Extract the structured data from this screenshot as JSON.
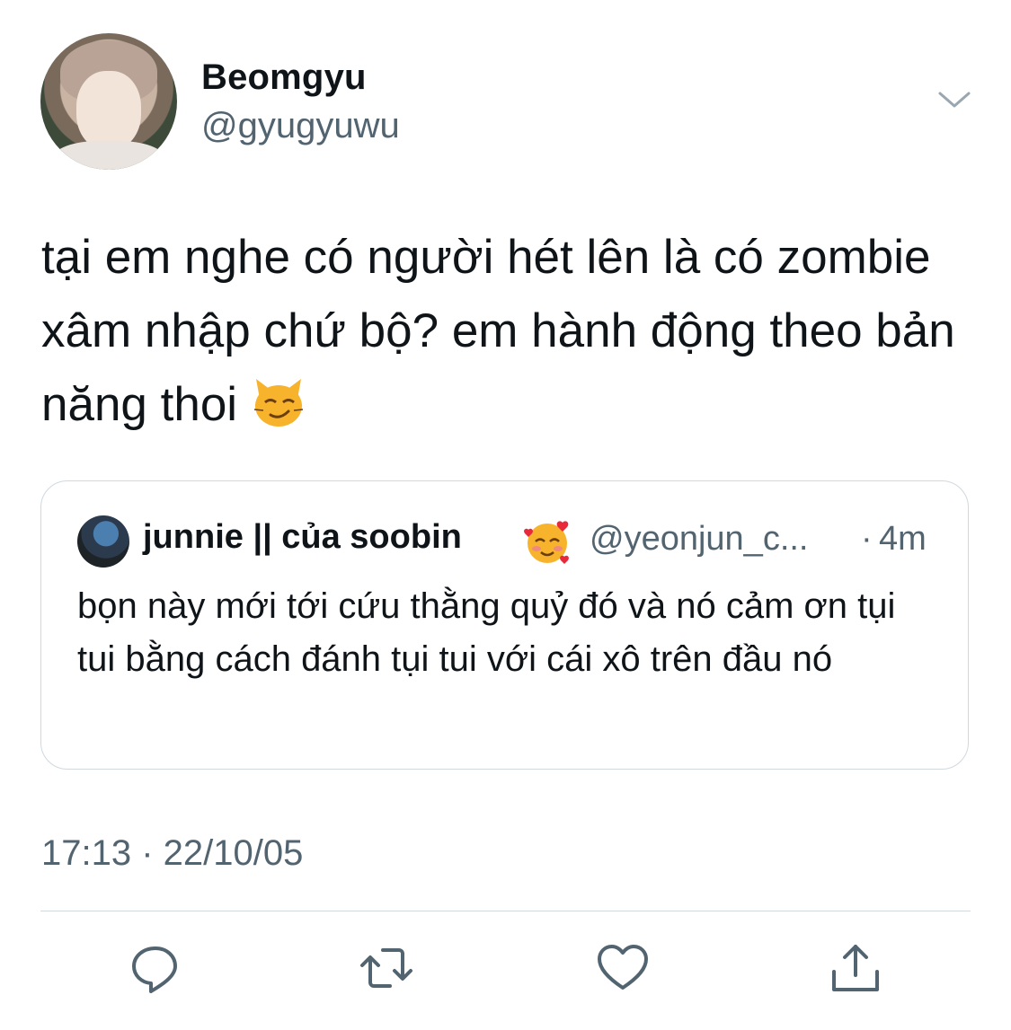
{
  "author": {
    "display_name": "Beomgyu",
    "handle": "@gyugyuwu"
  },
  "tweet": {
    "text": "tại em nghe có người hét lên là có zombie xâm nhập chứ bộ? em hành động theo bản năng thoi",
    "trailing_emoji": "smirking-cat-emoji",
    "timestamp": "17:13 · 22/10/05"
  },
  "quoted_tweet": {
    "display_name": "junnie || của soobin",
    "name_emoji": "smiling-face-with-hearts-emoji",
    "handle": "@yeonjun_c...",
    "separator": "·",
    "time_ago": "4m",
    "text": "bọn này mới tới cứu thằng quỷ đó và nó cảm ơn tụi tui bằng cách đánh tụi tui với cái xô trên đầu nó"
  },
  "actions": [
    {
      "name": "reply",
      "icon": "reply-icon"
    },
    {
      "name": "retweet",
      "icon": "retweet-icon"
    },
    {
      "name": "like",
      "icon": "heart-icon"
    },
    {
      "name": "share",
      "icon": "share-icon"
    }
  ],
  "colors": {
    "text": "#0f1419",
    "secondary": "#536471",
    "border": "#cfd9de"
  }
}
